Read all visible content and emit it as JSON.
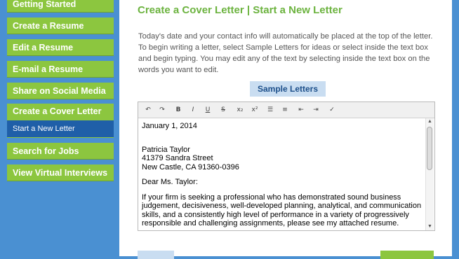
{
  "sidebar": {
    "items": [
      {
        "label": "Getting Started"
      },
      {
        "label": "Create a Resume"
      },
      {
        "label": "Edit a Resume"
      },
      {
        "label": "E-mail a Resume"
      },
      {
        "label": "Share on Social Media"
      },
      {
        "label": "Create a Cover Letter"
      },
      {
        "label": "Start a New Letter"
      },
      {
        "label": "Search for Jobs"
      },
      {
        "label": "View Virtual Interviews"
      }
    ]
  },
  "main": {
    "title": "Create a Cover Letter | Start a New Letter",
    "intro": "Today's date and your contact info will automatically be placed at the top of the letter. To begin writing a letter, select Sample Letters for ideas or select inside the text box and begin typing. You may edit any of the text by selecting inside the text box on the words you want to edit.",
    "sample_button": "Sample Letters"
  },
  "toolbar": {
    "bold": "B",
    "italic": "I",
    "underline": "U",
    "strike": "S",
    "subscript": "x₂",
    "superscript": "x²"
  },
  "editor": {
    "date": "January 1, 2014",
    "name": "Patricia Taylor",
    "street": "41379 Sandra Street",
    "city": "New Castle, CA 91360-0396",
    "salutation": "Dear Ms. Taylor:",
    "body": "If your firm is seeking a professional who has demonstrated sound business judgement, decisiveness, well-developed planning, analytical, and communication skills, and a consistently high level of performance in a variety of progressively responsible and challenging assignments, please see my attached resume."
  },
  "colors": {
    "page_bg": "#4a90d2",
    "nav_green": "#8cc63f",
    "nav_active": "#1f5fa8",
    "title_green": "#6cb33f",
    "sample_button_bg": "#c9ddf1"
  }
}
